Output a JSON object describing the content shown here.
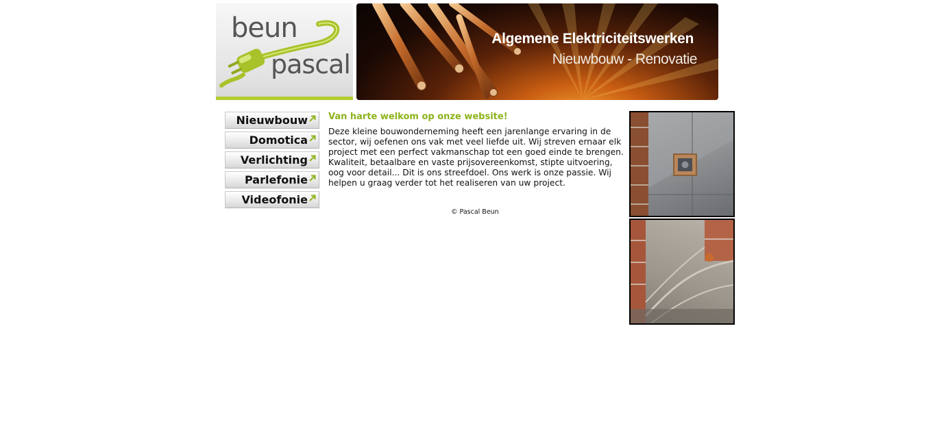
{
  "header": {
    "logo": {
      "name_top": "BEUN",
      "name_bottom": "PASCAL"
    },
    "banner": {
      "title": "Algemene Elektriciteitswerken",
      "subtitle": "Nieuwbouw - Renovatie"
    }
  },
  "nav": {
    "items": [
      {
        "label": "Nieuwbouw"
      },
      {
        "label": "Domotica"
      },
      {
        "label": "Verlichting"
      },
      {
        "label": "Parlefonie"
      },
      {
        "label": "Videofonie"
      }
    ],
    "arrow_icon": "arrow-up-right-icon",
    "arrow_color": "#8eb31c"
  },
  "content": {
    "title": "Van harte welkom op onze website!",
    "body": "Deze kleine bouwonderneming heeft een jarenlange ervaring in de sector, wij oefenen ons vak met veel liefde uit. Wij streven ernaar elk project met een perfect vakmanschap tot een goed einde te brengen. Kwaliteit, betaalbare en vaste prijsovereenkomst, stipte uitvoering, oog voor detail... Dit is ons streefdoel. Ons werk is onze passie. Wij helpen u graag verder tot het realiseren van uw project.",
    "copyright": "© Pascal Beun"
  },
  "colors": {
    "accent_green": "#8eb31c",
    "logo_underline": "#b5cc2e",
    "text": "#111111"
  }
}
